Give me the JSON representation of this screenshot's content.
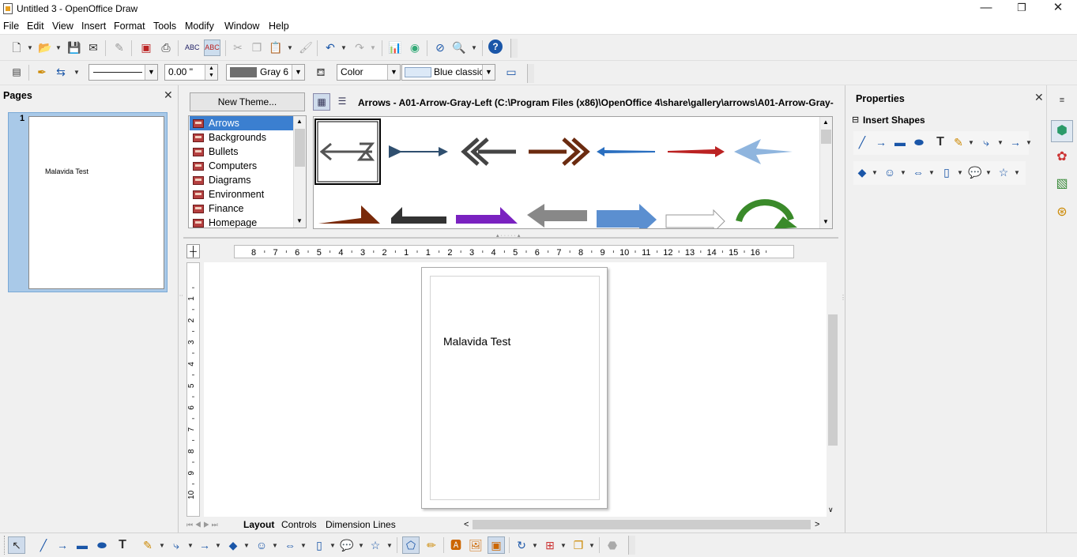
{
  "window": {
    "title": "Untitled 3 - OpenOffice Draw",
    "controls": {
      "minimize": "—",
      "maximize": "❐",
      "close": "✕"
    }
  },
  "menu": [
    "File",
    "Edit",
    "View",
    "Insert",
    "Format",
    "Tools",
    "Modify",
    "Window",
    "Help"
  ],
  "toolbar2": {
    "line_width": "0.00 \"",
    "line_color": "Gray 6",
    "area_style": "Color",
    "area_fill": "Blue classic"
  },
  "pages_panel": {
    "title": "Pages",
    "page_number": "1",
    "thumb_text": "Malavida Test"
  },
  "gallery": {
    "new_theme": "New Theme...",
    "path": "Arrows - A01-Arrow-Gray-Left (C:\\Program Files (x86)\\OpenOffice 4\\share\\gallery\\arrows\\A01-Arrow-Gray-",
    "themes": [
      "Arrows",
      "Backgrounds",
      "Bullets",
      "Computers",
      "Diagrams",
      "Environment",
      "Finance",
      "Homepage"
    ],
    "selected_theme": "Arrows"
  },
  "ruler": {
    "h_labels": [
      "8",
      "7",
      "6",
      "5",
      "4",
      "3",
      "2",
      "1",
      "1",
      "2",
      "3",
      "4",
      "5",
      "6",
      "7",
      "8",
      "9",
      "10",
      "11",
      "12",
      "13",
      "14",
      "15",
      "16"
    ],
    "v_labels": [
      "1",
      "2",
      "3",
      "4",
      "5",
      "6",
      "7",
      "8",
      "9",
      "10"
    ]
  },
  "document": {
    "text": "Malavida Test"
  },
  "layer_tabs": [
    "Layout",
    "Controls",
    "Dimension Lines"
  ],
  "properties": {
    "title": "Properties",
    "section": "Insert Shapes"
  },
  "colors": {
    "accent": "#3b7fd0",
    "thumb_sel": "#a9c9e8",
    "gray6": "#6e6e6e",
    "blue_classic": "#dce9f7"
  }
}
